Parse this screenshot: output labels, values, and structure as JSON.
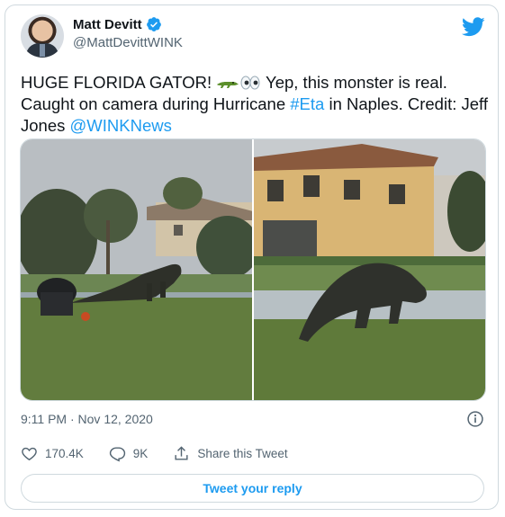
{
  "author": {
    "name": "Matt Devitt",
    "handle": "@MattDevittWINK"
  },
  "tweet": {
    "text_part1": "HUGE FLORIDA GATOR! ",
    "text_part2": " Yep, this monster is real. Caught on camera during Hurricane ",
    "hashtag": "#Eta",
    "text_part3": " in Naples. Credit: Jeff Jones ",
    "mention": "@WINKNews"
  },
  "media": {
    "photo_left": "alligator-photo-left",
    "photo_right": "alligator-photo-right"
  },
  "meta": {
    "timestamp": "9:11 PM · Nov 12, 2020"
  },
  "actions": {
    "likes": "170.4K",
    "replies": "9K",
    "share_label": "Share this Tweet"
  },
  "reply_button": "Tweet your reply",
  "colors": {
    "accent": "#1d9bf0",
    "text": "#0f1419",
    "secondary": "#536471",
    "border": "#cfd9de"
  }
}
